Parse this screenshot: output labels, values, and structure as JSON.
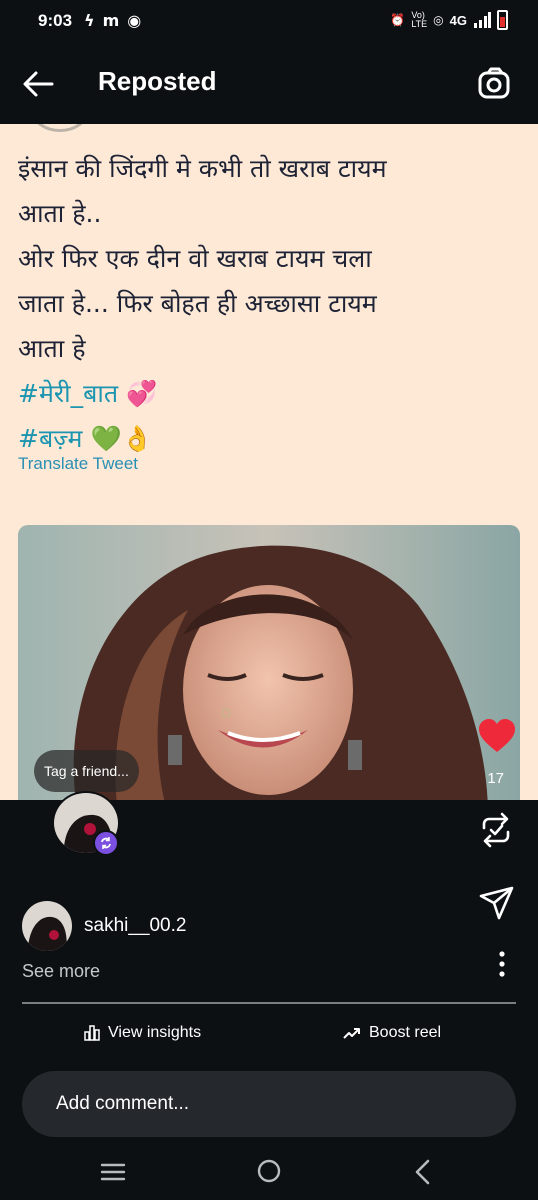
{
  "status_bar": {
    "time": "9:03",
    "left_icons": [
      "flash-icon",
      "m-icon",
      "whatsapp-icon"
    ],
    "right_icons": [
      "alarm-icon",
      "volte-icon",
      "hotspot-icon",
      "signal-icon",
      "battery-icon"
    ],
    "network": "4G"
  },
  "header": {
    "title": "Reposted",
    "back_icon": "arrow-left-icon",
    "camera_icon": "camera-flip-icon"
  },
  "tweet": {
    "lines": [
      "इंसान की जिंदगी मे कभी तो खराब टायम",
      "आता हे..",
      "ओर फिर एक दीन वो खराब टायम चला",
      "जाता हे... फिर बोहत ही अच्छासा टायम",
      "आता हे"
    ],
    "hashtag1": "#मेरी_बात",
    "hashtag1_emoji": "💞",
    "hashtag2": "#बज़्म",
    "hashtag2_emoji": "💚👌",
    "translate_label": "Translate Tweet"
  },
  "overlay": {
    "like_count": "17",
    "tag_label": "Tag a friend..."
  },
  "post": {
    "username": "sakhi__00.2",
    "see_more": "See more"
  },
  "actions": {
    "insights_label": "View insights",
    "boost_label": "Boost reel"
  },
  "comment": {
    "placeholder": "Add comment..."
  },
  "colors": {
    "background": "#0d1013",
    "tweet_bg": "#fde9d6",
    "tweet_text": "#1e2235",
    "hashtag": "#1b95b0",
    "like_red": "#ee2a3a",
    "repost_badge": "#7b4fe0",
    "comment_bg": "#25292e"
  }
}
